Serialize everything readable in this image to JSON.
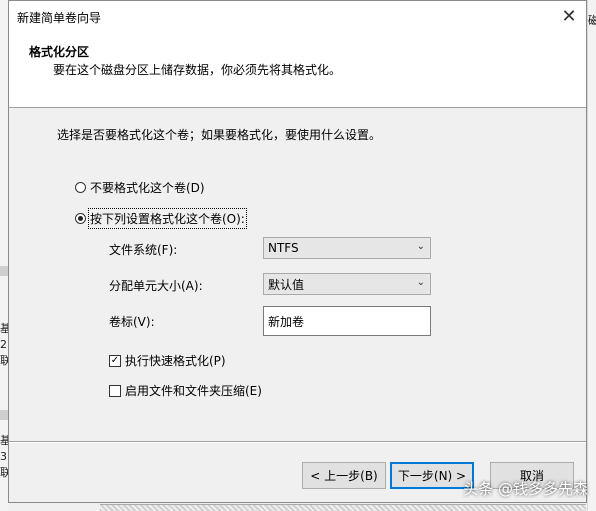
{
  "window": {
    "title": "新建简单卷向导",
    "close_glyph": "✕"
  },
  "header": {
    "title": "格式化分区",
    "subtitle": "要在这个磁盘分区上储存数据，你必须先将其格式化。"
  },
  "intro": "选择是否要格式化这个卷；如果要格式化，要使用什么设置。",
  "options": {
    "no_format": {
      "label": "不要格式化这个卷(D)",
      "selected": false
    },
    "format_with": {
      "label": "按下列设置格式化这个卷(O):",
      "selected": true
    }
  },
  "fields": {
    "file_system": {
      "label": "文件系统(F):",
      "value": "NTFS"
    },
    "allocation_unit": {
      "label": "分配单元大小(A):",
      "value": "默认值"
    },
    "volume_label": {
      "label": "卷标(V):",
      "value": "新加卷"
    }
  },
  "checkboxes": {
    "quick_format": {
      "label": "执行快速格式化(P)",
      "checked": true
    },
    "compression": {
      "label": "启用文件和文件夹压缩(E)",
      "checked": false
    }
  },
  "buttons": {
    "back": "< 上一步(B)",
    "next": "下一步(N) >",
    "cancel": "取消"
  },
  "background": {
    "right_glyph": "磁",
    "fragments": [
      "基",
      "2",
      "联",
      "基",
      "3",
      "联"
    ]
  },
  "watermark": "头条 @钱多多先森"
}
